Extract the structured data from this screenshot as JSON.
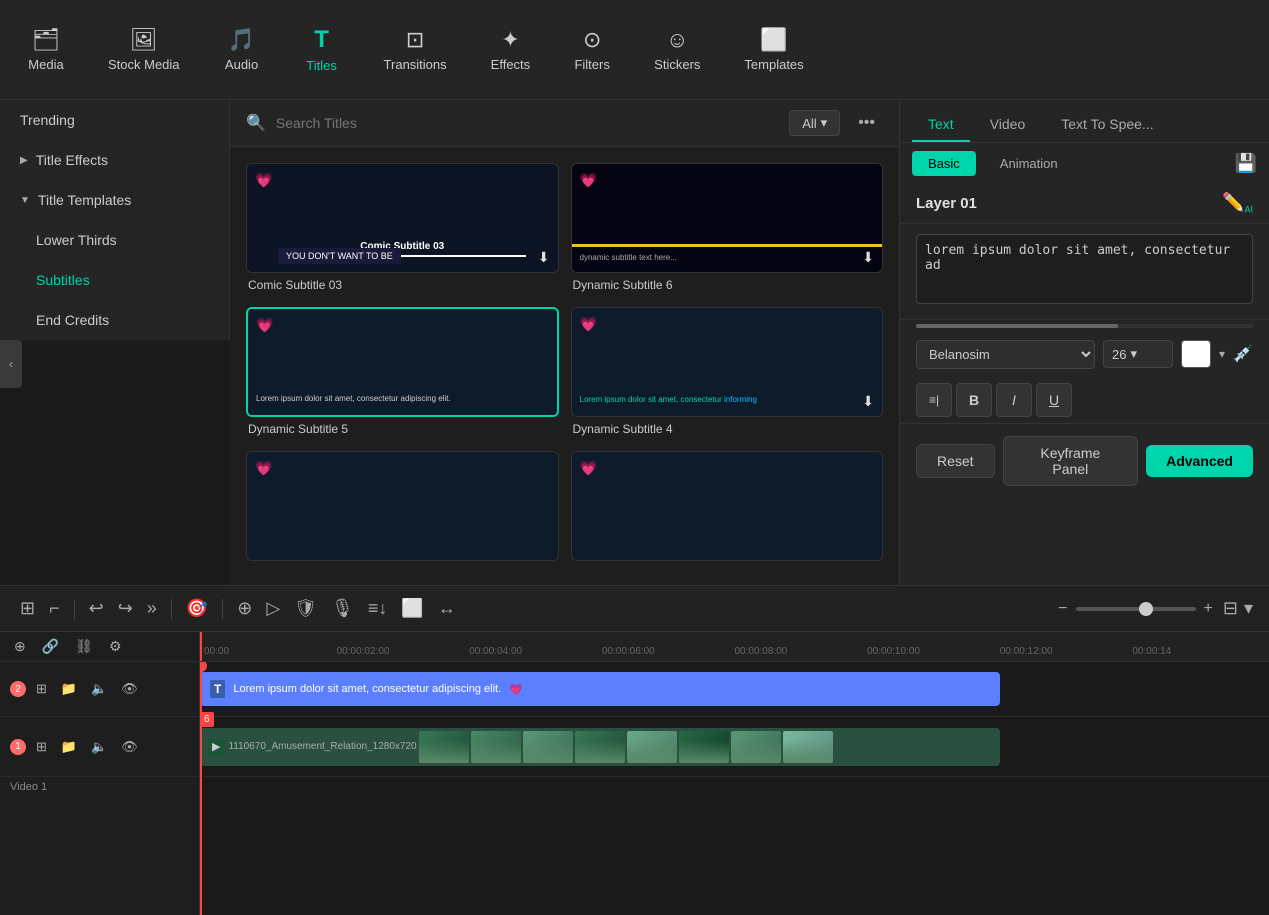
{
  "topnav": {
    "items": [
      {
        "id": "media",
        "label": "Media",
        "icon": "🗂",
        "active": false
      },
      {
        "id": "stock-media",
        "label": "Stock Media",
        "icon": "🖼",
        "active": false
      },
      {
        "id": "audio",
        "label": "Audio",
        "icon": "🎵",
        "active": false
      },
      {
        "id": "titles",
        "label": "Titles",
        "icon": "T",
        "active": true
      },
      {
        "id": "transitions",
        "label": "Transitions",
        "icon": "▶",
        "active": false
      },
      {
        "id": "effects",
        "label": "Effects",
        "icon": "✦",
        "active": false
      },
      {
        "id": "filters",
        "label": "Filters",
        "icon": "⊙",
        "active": false
      },
      {
        "id": "stickers",
        "label": "Stickers",
        "icon": "☺",
        "active": false
      },
      {
        "id": "templates",
        "label": "Templates",
        "icon": "⬜",
        "active": false
      }
    ]
  },
  "sidebar": {
    "trending_label": "Trending",
    "items": [
      {
        "id": "title-effects",
        "label": "Title Effects",
        "expanded": false
      },
      {
        "id": "title-templates",
        "label": "Title Templates",
        "expanded": true
      },
      {
        "id": "lower-thirds",
        "label": "Lower Thirds",
        "indent": true,
        "active": false
      },
      {
        "id": "subtitles",
        "label": "Subtitles",
        "indent": true,
        "active": true
      },
      {
        "id": "end-credits",
        "label": "End Credits",
        "indent": true,
        "active": false
      }
    ]
  },
  "search": {
    "placeholder": "Search Titles",
    "filter_label": "All",
    "filter_arrow": "▾"
  },
  "titles_grid": {
    "cards": [
      {
        "id": "comic-subtitle-03",
        "name": "Comic Subtitle 03",
        "selected": false
      },
      {
        "id": "dynamic-subtitle-6",
        "name": "Dynamic Subtitle 6",
        "selected": false
      },
      {
        "id": "dynamic-subtitle-5",
        "name": "Dynamic Subtitle 5",
        "selected": true
      },
      {
        "id": "dynamic-subtitle-4",
        "name": "Dynamic Subtitle 4",
        "selected": false
      },
      {
        "id": "card5",
        "name": "",
        "selected": false
      },
      {
        "id": "card6",
        "name": "",
        "selected": false
      }
    ]
  },
  "right_panel": {
    "tabs": [
      {
        "id": "text",
        "label": "Text",
        "active": true
      },
      {
        "id": "video",
        "label": "Video",
        "active": false
      },
      {
        "id": "text-to-speech",
        "label": "Text To Spee...",
        "active": false
      }
    ],
    "subtabs": [
      {
        "id": "basic",
        "label": "Basic",
        "active": true
      },
      {
        "id": "animation",
        "label": "Animation",
        "active": false
      }
    ],
    "layer_title": "Layer 01",
    "text_content": "lorem ipsum dolor sit amet, consectetur ad",
    "font_name": "Belanosim▾",
    "font_size": "26",
    "color": "#ffffff",
    "formatting": [
      "≡|",
      "B",
      "I",
      "U"
    ],
    "buttons": {
      "reset": "Reset",
      "keyframe": "Keyframe Panel",
      "advanced": "Advanced"
    }
  },
  "timeline": {
    "toolbar_buttons": [
      "⊞",
      "⌐",
      "|",
      "↩",
      "↪",
      "»",
      "|",
      "🎯",
      "|",
      "⊕",
      "▶",
      "🛡",
      "🎙",
      "≡↓",
      "⬜",
      "↔"
    ],
    "ruler_marks": [
      "00:00:00",
      "00:00:02:00",
      "00:00:04:00",
      "00:00:06:00",
      "00:00:08:00",
      "00:00:10:00",
      "00:00:12:00",
      "00:00:14"
    ],
    "tracks": [
      {
        "id": "track2",
        "badge": "2",
        "icons": [
          "⊞",
          "📁",
          "🔈",
          "👁"
        ],
        "clip_text": "Lorem ipsum dolor sit amet, consectetur adipiscing elit.",
        "clip_icon": "T",
        "clip_heart": "💗"
      },
      {
        "id": "track1",
        "badge": "1",
        "icons": [
          "⊞",
          "📁",
          "🔈",
          "👁"
        ],
        "clip_text": "1110670_Amusement_Relation_1280x720",
        "clip_icon": "▶"
      }
    ],
    "video_label": "Video 1"
  }
}
